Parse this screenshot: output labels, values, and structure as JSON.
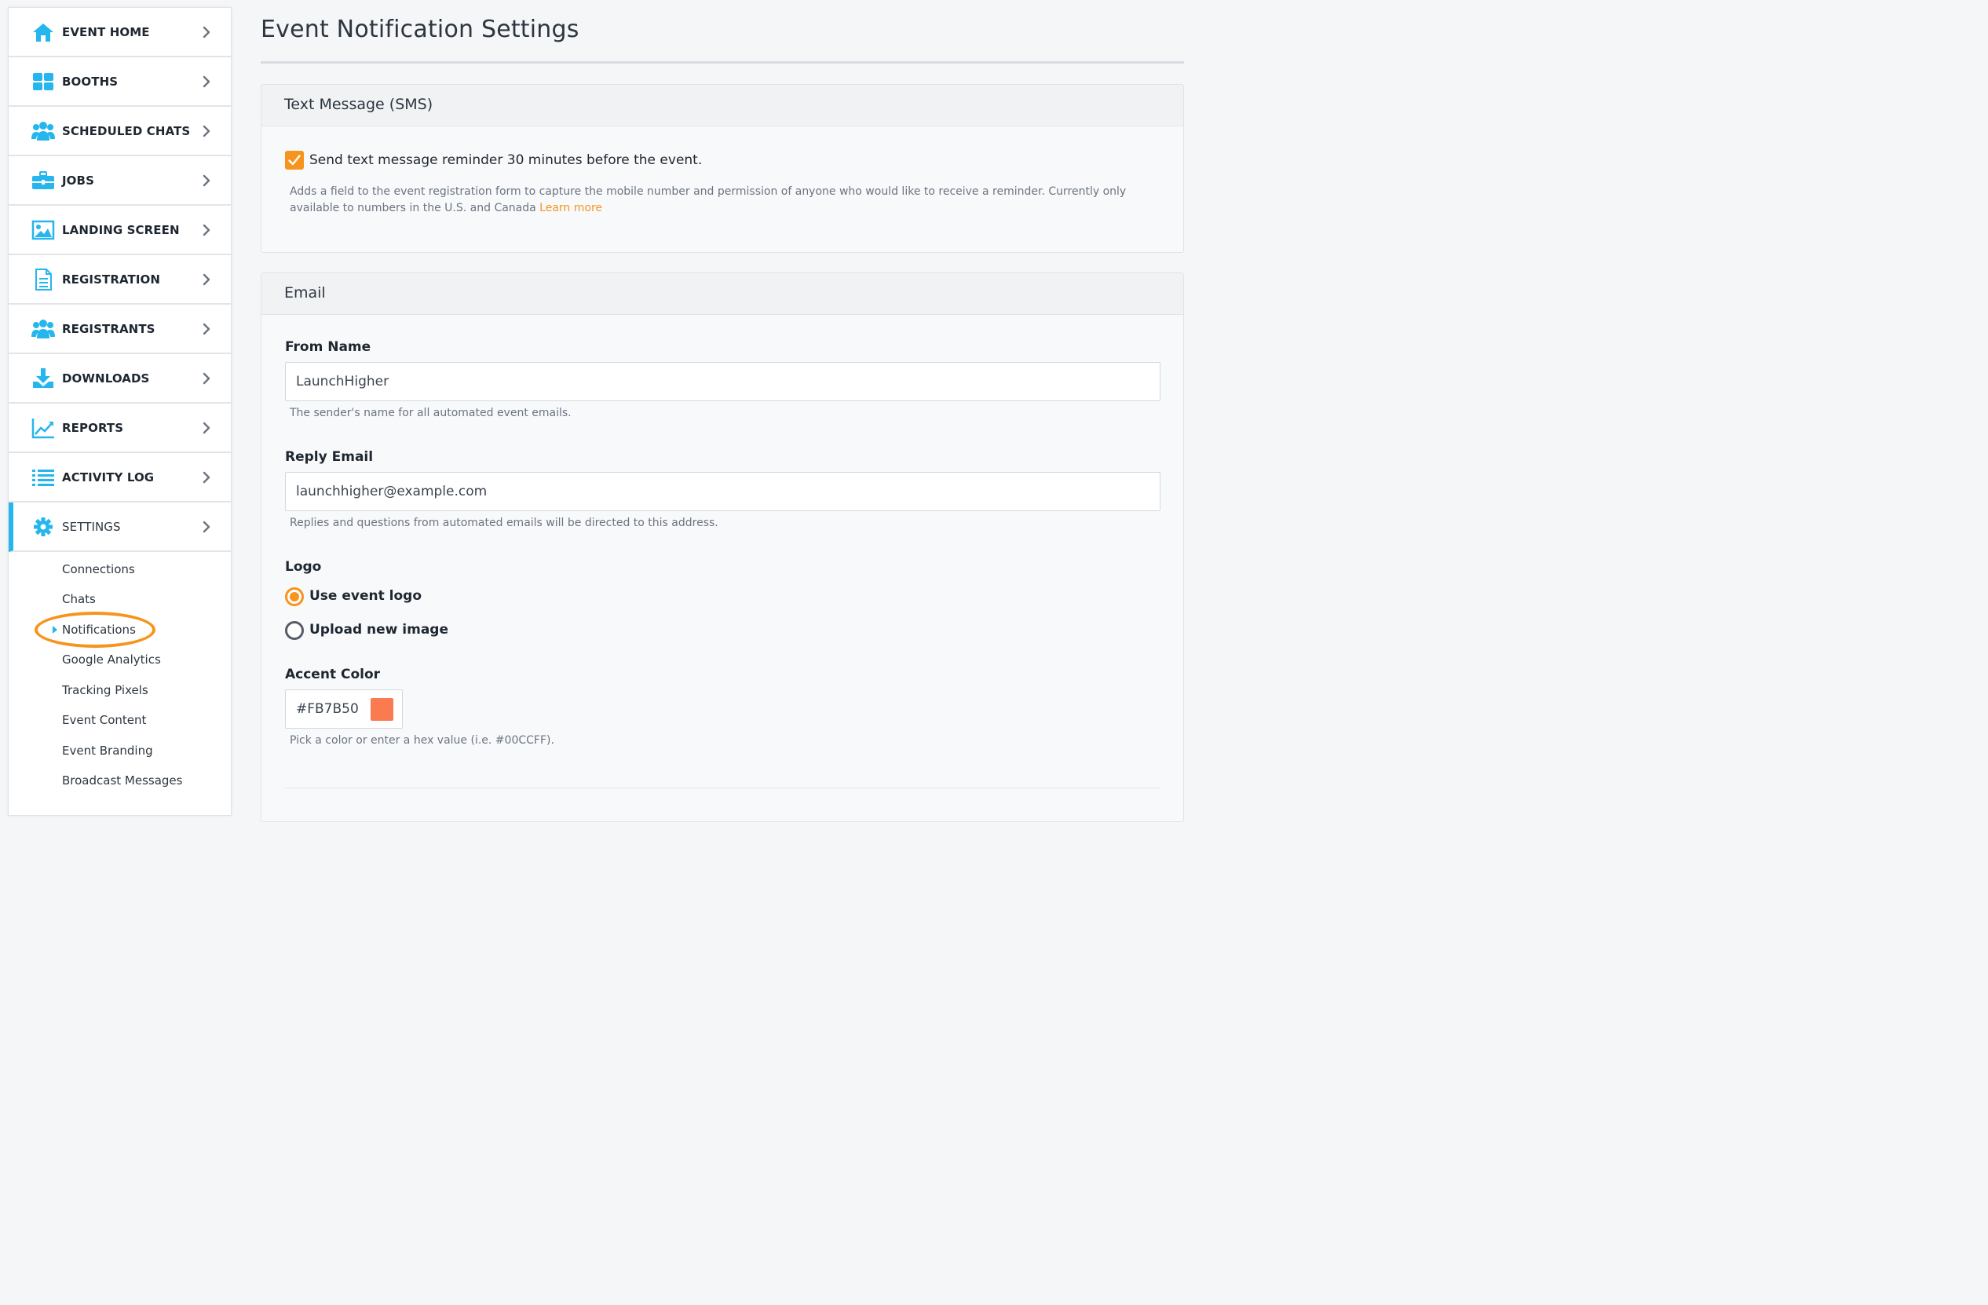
{
  "page": {
    "title": "Event Notification Settings"
  },
  "colors": {
    "accent_orange": "#f7941d",
    "nav_icon_blue": "#25b6ee",
    "swatch": "#FB7B50"
  },
  "sidebar": {
    "items": [
      {
        "label": "EVENT HOME",
        "icon": "home-icon"
      },
      {
        "label": "BOOTHS",
        "icon": "grid-icon"
      },
      {
        "label": "SCHEDULED CHATS",
        "icon": "people-group-icon"
      },
      {
        "label": "JOBS",
        "icon": "briefcase-icon"
      },
      {
        "label": "LANDING SCREEN",
        "icon": "image-icon"
      },
      {
        "label": "REGISTRATION",
        "icon": "document-icon"
      },
      {
        "label": "REGISTRANTS",
        "icon": "people-group-icon"
      },
      {
        "label": "DOWNLOADS",
        "icon": "download-icon"
      },
      {
        "label": "REPORTS",
        "icon": "line-chart-icon"
      },
      {
        "label": "ACTIVITY LOG",
        "icon": "list-icon"
      },
      {
        "label": "SETTINGS",
        "icon": "gear-icon"
      }
    ],
    "settings_sub": [
      "Connections",
      "Chats",
      "Notifications",
      "Google Analytics",
      "Tracking Pixels",
      "Event Content",
      "Event Branding",
      "Broadcast Messages"
    ],
    "active_sub": "Notifications"
  },
  "sms": {
    "heading": "Text Message (SMS)",
    "checkbox_label": "Send text message reminder 30 minutes before the event.",
    "checked": true,
    "help_text": "Adds a field to the event registration form to capture the mobile number and permission of anyone who would like to receive a reminder. Currently only available to numbers in the U.S. and Canada",
    "learn_more": "Learn more"
  },
  "email": {
    "heading": "Email",
    "from_name": {
      "label": "From Name",
      "value": "LaunchHigher",
      "help": "The sender's name for all automated event emails."
    },
    "reply_email": {
      "label": "Reply Email",
      "value": "launchhigher@example.com",
      "help": "Replies and questions from automated emails will be directed to this address."
    },
    "logo": {
      "label": "Logo",
      "option_1": "Use event logo",
      "option_2": "Upload new image",
      "selected": "Use event logo"
    },
    "accent_color": {
      "label": "Accent Color",
      "value": "#FB7B50",
      "help": "Pick a color or enter a hex value (i.e. #00CCFF)."
    }
  }
}
